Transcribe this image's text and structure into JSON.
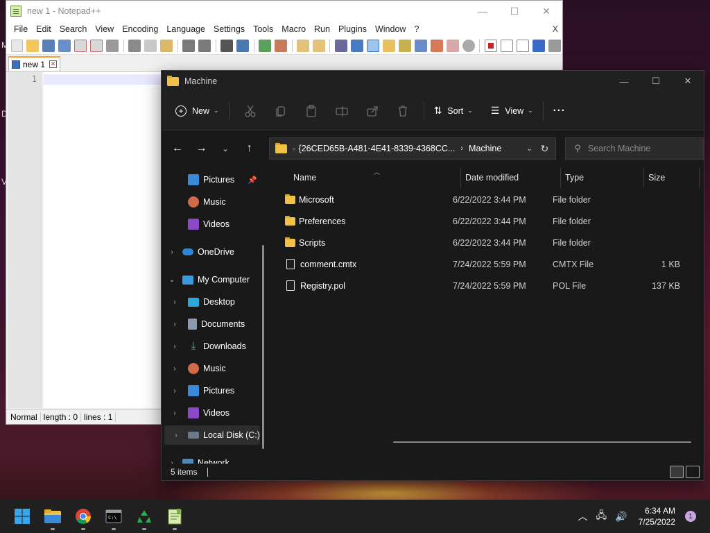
{
  "desktop": {
    "peek_letters": [
      "M",
      "D",
      "V"
    ]
  },
  "notepad": {
    "title": "new 1 - Notepad++",
    "menu": [
      "File",
      "Edit",
      "Search",
      "View",
      "Encoding",
      "Language",
      "Settings",
      "Tools",
      "Macro",
      "Run",
      "Plugins",
      "Window",
      "?"
    ],
    "menu_close": "X",
    "tab_label": "new 1",
    "line_number": "1",
    "status": {
      "mode": "Normal",
      "length": "length : 0",
      "lines": "lines : 1"
    }
  },
  "explorer": {
    "title": "Machine",
    "commands": {
      "new_label": "New",
      "sort_label": "Sort",
      "view_label": "View",
      "more_label": "···"
    },
    "address": {
      "guid": "{26CED65B-A481-4E41-8339-4368CC...",
      "current": "Machine"
    },
    "search_placeholder": "Search Machine",
    "nav": [
      {
        "label": "Pictures",
        "icon": "pictures-icon",
        "pinned": true
      },
      {
        "label": "Music",
        "icon": "music-icon"
      },
      {
        "label": "Videos",
        "icon": "videos-icon"
      },
      {
        "label": "OneDrive",
        "icon": "onedrive-icon"
      },
      {
        "label": "My Computer",
        "icon": "computer-icon"
      },
      {
        "label": "Desktop",
        "icon": "desktop-icon"
      },
      {
        "label": "Documents",
        "icon": "documents-icon"
      },
      {
        "label": "Downloads",
        "icon": "downloads-icon"
      },
      {
        "label": "Music",
        "icon": "music-icon"
      },
      {
        "label": "Pictures",
        "icon": "pictures-icon"
      },
      {
        "label": "Videos",
        "icon": "videos-icon"
      },
      {
        "label": "Local Disk (C:)",
        "icon": "drive-icon"
      },
      {
        "label": "Network",
        "icon": "network-icon"
      }
    ],
    "columns": {
      "name": "Name",
      "date": "Date modified",
      "type": "Type",
      "size": "Size"
    },
    "files": [
      {
        "name": "Microsoft",
        "date": "6/22/2022 3:44 PM",
        "type": "File folder",
        "size": "",
        "kind": "folder"
      },
      {
        "name": "Preferences",
        "date": "6/22/2022 3:44 PM",
        "type": "File folder",
        "size": "",
        "kind": "folder"
      },
      {
        "name": "Scripts",
        "date": "6/22/2022 3:44 PM",
        "type": "File folder",
        "size": "",
        "kind": "folder"
      },
      {
        "name": "comment.cmtx",
        "date": "7/24/2022 5:59 PM",
        "type": "CMTX File",
        "size": "1 KB",
        "kind": "file"
      },
      {
        "name": "Registry.pol",
        "date": "7/24/2022 5:59 PM",
        "type": "POL File",
        "size": "137 KB",
        "kind": "file"
      }
    ],
    "status_count": "5 items"
  },
  "taskbar": {
    "apps": [
      "start-icon",
      "file-explorer-icon",
      "chrome-icon",
      "terminal-icon",
      "recycle-app-icon",
      "notepad-plus-icon"
    ],
    "time": "6:34 AM",
    "date": "7/25/2022",
    "notification_count": "1"
  },
  "colors": {
    "explorer_bg": "#191919",
    "folder": "#f0c348",
    "npp_tab_accent": "#f7a12a",
    "taskbar": "#202020"
  }
}
